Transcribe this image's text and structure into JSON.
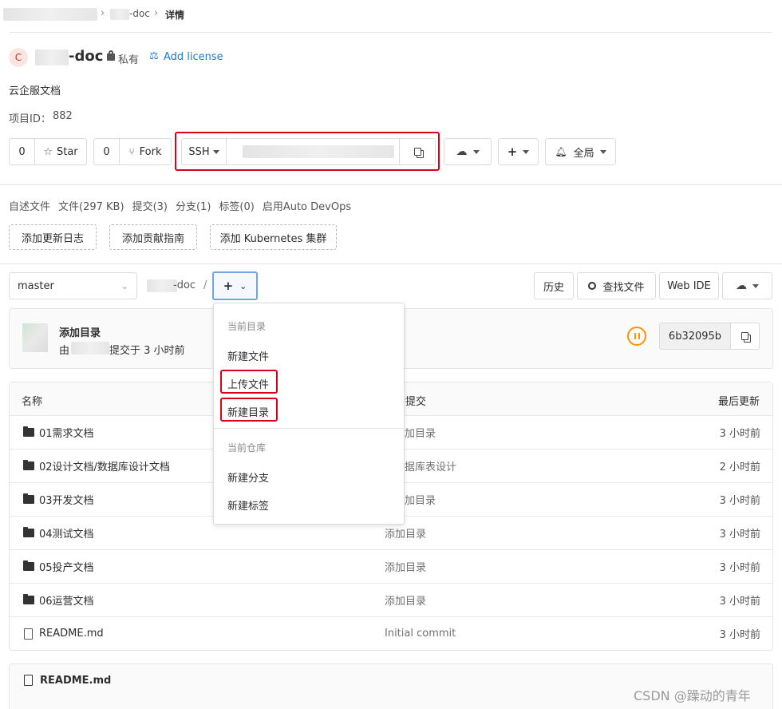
{
  "breadcrumb": {
    "sep": "›",
    "project": "-doc",
    "current": "详情"
  },
  "project": {
    "avatar_letter": "C",
    "name": "-doc",
    "visibility": "私有",
    "license_link": "Add license",
    "description": "云企服文档",
    "id_label": "项目ID：",
    "id_value": "882"
  },
  "actions": {
    "star_count": "0",
    "star_label": "Star",
    "fork_count": "0",
    "fork_label": "Fork",
    "clone_protocol": "SSH",
    "notify_label": "全局"
  },
  "stats": [
    {
      "label": "自述文件"
    },
    {
      "label": "文件(297 KB)"
    },
    {
      "label": "提交(3)"
    },
    {
      "label": "分支(1)"
    },
    {
      "label": "标签(0)"
    },
    {
      "label": "启用Auto DevOps"
    }
  ],
  "suggest_buttons": [
    "添加更新日志",
    "添加贡献指南",
    "添加 Kubernetes 集群"
  ],
  "repo_toolbar": {
    "branch": "master",
    "path_root": "-doc",
    "path_sep": "/",
    "add_label": "+",
    "history": "历史",
    "find_file": "查找文件",
    "web_ide": "Web IDE"
  },
  "last_commit": {
    "message": "添加目录",
    "by": "由",
    "when": "提交于 3 小时前",
    "sha": "6b32095b"
  },
  "dropdown": {
    "header_dir": "当前目录",
    "new_file": "新建文件",
    "upload_file": "上传文件",
    "new_dir": "新建目录",
    "header_repo": "当前仓库",
    "new_branch": "新建分支",
    "new_tag": "新建标签"
  },
  "table": {
    "col_name": "名称",
    "col_commit": "后提交",
    "col_updated": "最后更新",
    "rows": [
      {
        "name": "01需求文档",
        "commit": "加目录",
        "updated": "3 小时前",
        "type": "folder"
      },
      {
        "name": "02设计文档/数据库设计文档",
        "commit": "据库表设计",
        "updated": "2 小时前",
        "type": "folder"
      },
      {
        "name": "03开发文档",
        "commit": "加目录",
        "updated": "3 小时前",
        "type": "folder"
      },
      {
        "name": "04测试文档",
        "commit": "添加目录",
        "updated": "3 小时前",
        "type": "folder"
      },
      {
        "name": "05投产文档",
        "commit": "添加目录",
        "updated": "3 小时前",
        "type": "folder"
      },
      {
        "name": "06运营文档",
        "commit": "添加目录",
        "updated": "3 小时前",
        "type": "folder"
      },
      {
        "name": "README.md",
        "commit": "Initial commit",
        "updated": "3 小时前",
        "type": "file"
      }
    ]
  },
  "readme": {
    "title": "README.md"
  },
  "watermark": "CSDN @躁动的青年",
  "colors": {
    "highlight": "#d9001b",
    "link": "#1f78d1",
    "pipeline": "#fc9403"
  }
}
